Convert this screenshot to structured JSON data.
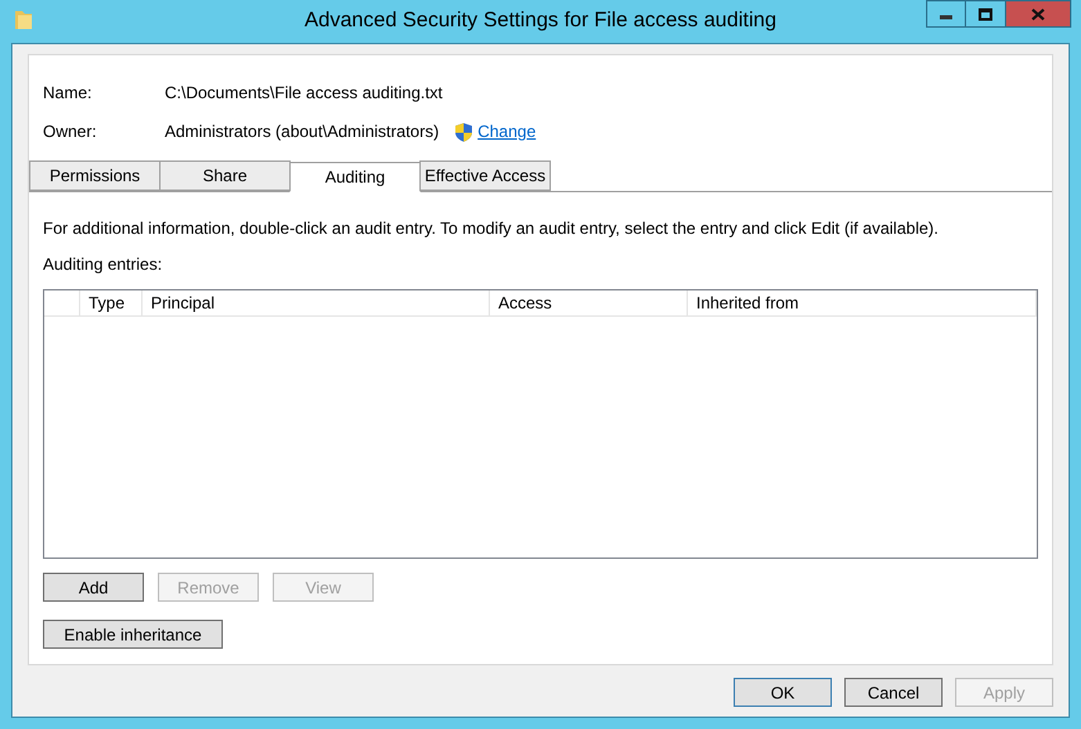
{
  "window": {
    "title": "Advanced Security Settings for File access auditing"
  },
  "fields": [
    {
      "label": "Name:",
      "value": "C:\\Documents\\File access auditing.txt"
    },
    {
      "label": "Owner:",
      "value": "Administrators (about\\Administrators)",
      "link": "Change"
    }
  ],
  "tabs": [
    {
      "label": "Permissions",
      "selected": false
    },
    {
      "label": "Share",
      "selected": false
    },
    {
      "label": "Auditing",
      "selected": true
    },
    {
      "label": "Effective Access",
      "selected": false
    }
  ],
  "info": "For additional information, double-click an audit entry. To modify an audit entry, select the entry and click Edit (if available).",
  "table": {
    "label": "Auditing entries:",
    "columns": [
      "Type",
      "Principal",
      "Access",
      "Inherited from"
    ]
  },
  "entry_buttons": [
    {
      "label": "Add",
      "disabled": false
    },
    {
      "label": "Remove",
      "disabled": true
    },
    {
      "label": "View",
      "disabled": true
    }
  ],
  "inheritance_button": {
    "label": "Enable inheritance",
    "disabled": false
  },
  "dialog_buttons": [
    {
      "label": "OK",
      "disabled": false,
      "default": true
    },
    {
      "label": "Cancel",
      "disabled": false,
      "default": false
    },
    {
      "label": "Apply",
      "disabled": true,
      "default": false
    }
  ]
}
